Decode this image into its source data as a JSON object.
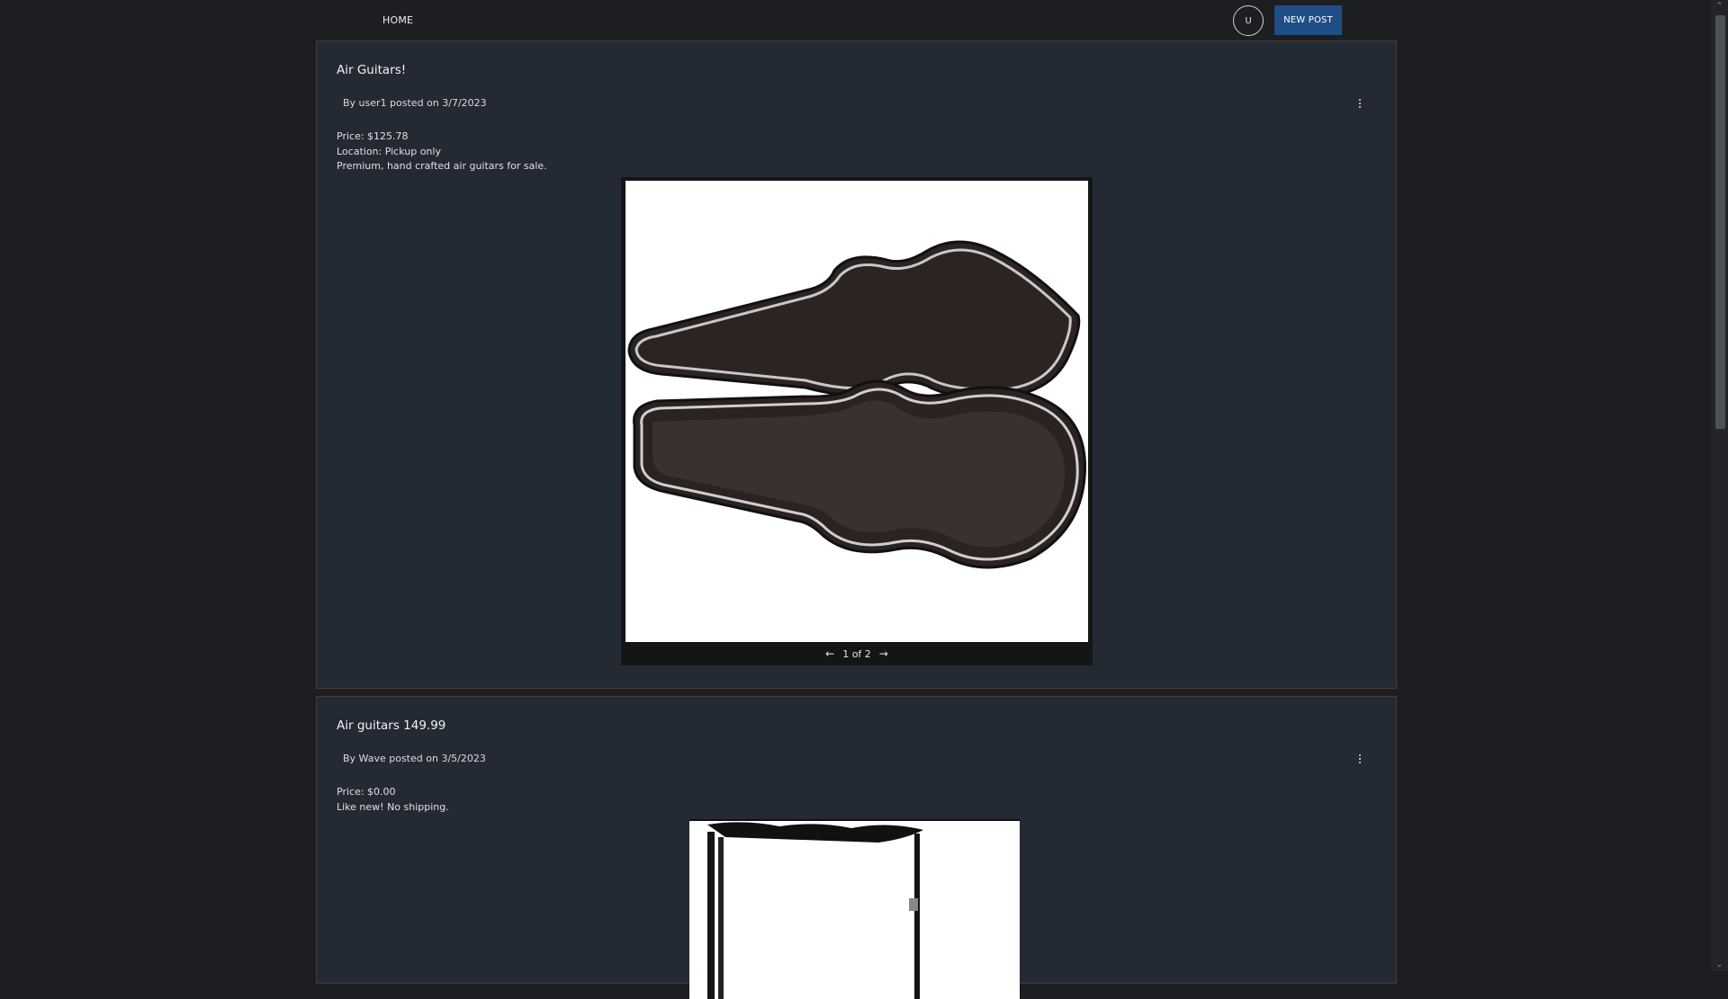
{
  "nav": {
    "home_label": "HOME",
    "avatar_initial": "U",
    "new_post_label": "NEW POST"
  },
  "posts": [
    {
      "title": "Air Guitars!",
      "meta": "By user1 posted on 3/7/2023",
      "body": [
        "Price: $125.78",
        "Location: Pickup only",
        "Premium, hand crafted air guitars for sale."
      ],
      "carousel": {
        "counter": "1 of 2"
      }
    },
    {
      "title": "Air guitars 149.99",
      "meta": "By Wave posted on 3/5/2023",
      "body": [
        "Price: $0.00",
        "Like new! No shipping."
      ]
    }
  ],
  "icons": {
    "kebab": "more-vert-icon",
    "prev": "arrow-left-icon",
    "next": "arrow-right-icon"
  },
  "colors": {
    "background": "#1c1e22",
    "card": "#232a33",
    "accent": "#1f4e86"
  }
}
